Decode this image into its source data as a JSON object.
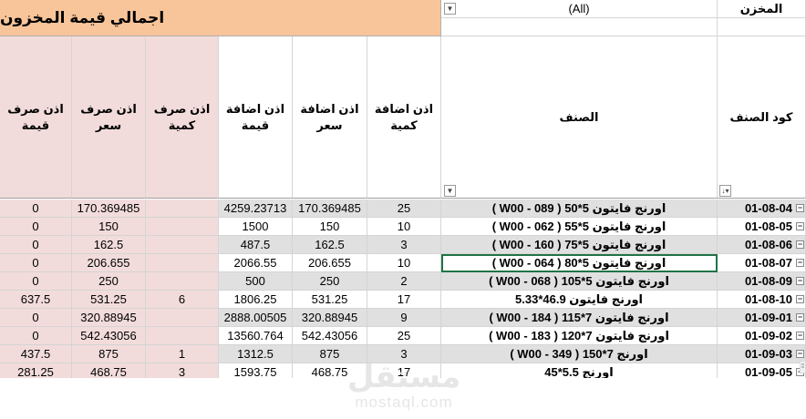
{
  "header": {
    "title": "اجمالي قيمة المخزون",
    "filter_label": "المخزن",
    "filter_value": "(All)"
  },
  "columns": {
    "code": "كود الصنف",
    "item": "الصنف",
    "add_qty": "اذن اضافة\nكمية",
    "add_price": "اذن اضافة\nسعر",
    "add_value": "اذن اضافة\nقيمة",
    "out_qty": "اذن صرف\nكمية",
    "out_price": "اذن صرف\nسعر",
    "out_value": "اذن صرف\nقيمة"
  },
  "rows": [
    {
      "code": "01-08-04",
      "item": "اورنج فايتون 5*50 ( W00 - 089 )",
      "add_qty": "25",
      "add_price": "170.369485",
      "add_value": "4259.23713",
      "out_qty": "",
      "out_price": "170.369485",
      "out_value": "0"
    },
    {
      "code": "01-08-05",
      "item": "اورنج فايتون 5*55 ( W00 - 062 )",
      "add_qty": "10",
      "add_price": "150",
      "add_value": "1500",
      "out_qty": "",
      "out_price": "150",
      "out_value": "0"
    },
    {
      "code": "01-08-06",
      "item": "اورنج فايتون 5*75 ( W00 - 160 )",
      "add_qty": "3",
      "add_price": "162.5",
      "add_value": "487.5",
      "out_qty": "",
      "out_price": "162.5",
      "out_value": "0"
    },
    {
      "code": "01-08-07",
      "item": "اورنج فايتون 5*80 ( W00 - 064 )",
      "add_qty": "10",
      "add_price": "206.655",
      "add_value": "2066.55",
      "out_qty": "",
      "out_price": "206.655",
      "out_value": "0"
    },
    {
      "code": "01-08-09",
      "item": "اورنج فايتون 5*105 ( W00 - 068 )",
      "add_qty": "2",
      "add_price": "250",
      "add_value": "500",
      "out_qty": "",
      "out_price": "250",
      "out_value": "0"
    },
    {
      "code": "01-08-10",
      "item": "اورنج فايتون 46.9*5.33",
      "add_qty": "17",
      "add_price": "531.25",
      "add_value": "1806.25",
      "out_qty": "6",
      "out_price": "531.25",
      "out_value": "637.5"
    },
    {
      "code": "01-09-01",
      "item": "اورنج فايتون 7*115 ( W00 - 184 )",
      "add_qty": "9",
      "add_price": "320.88945",
      "add_value": "2888.00505",
      "out_qty": "",
      "out_price": "320.88945",
      "out_value": "0"
    },
    {
      "code": "01-09-02",
      "item": "اورنج فايتون 7*120 ( W00 - 183 )",
      "add_qty": "25",
      "add_price": "542.43056",
      "add_value": "13560.764",
      "out_qty": "",
      "out_price": "542.43056",
      "out_value": "0"
    },
    {
      "code": "01-09-03",
      "item": "اورنج 7*150 ( W00 - 349 )",
      "add_qty": "3",
      "add_price": "875",
      "add_value": "1312.5",
      "out_qty": "1",
      "out_price": "875",
      "out_value": "437.5"
    },
    {
      "code": "01-09-05",
      "item": "اورنج 5.5*45",
      "add_qty": "17",
      "add_price": "468.75",
      "add_value": "1593.75",
      "out_qty": "3",
      "out_price": "468.75",
      "out_value": "281.25"
    }
  ],
  "selected_row": 3,
  "watermark": {
    "arabic": "مستقل",
    "latin": "mostaql.com"
  },
  "icons": {
    "filter": "dropdown-arrow-icon",
    "sort_filter": "sort-filter-icon",
    "expand": "collapse-minus-icon"
  },
  "colors": {
    "title_bg": "#f8c49a",
    "pink_bg": "#f2dcdb",
    "grey_row": "#e0e0e0",
    "selection": "#217346"
  }
}
